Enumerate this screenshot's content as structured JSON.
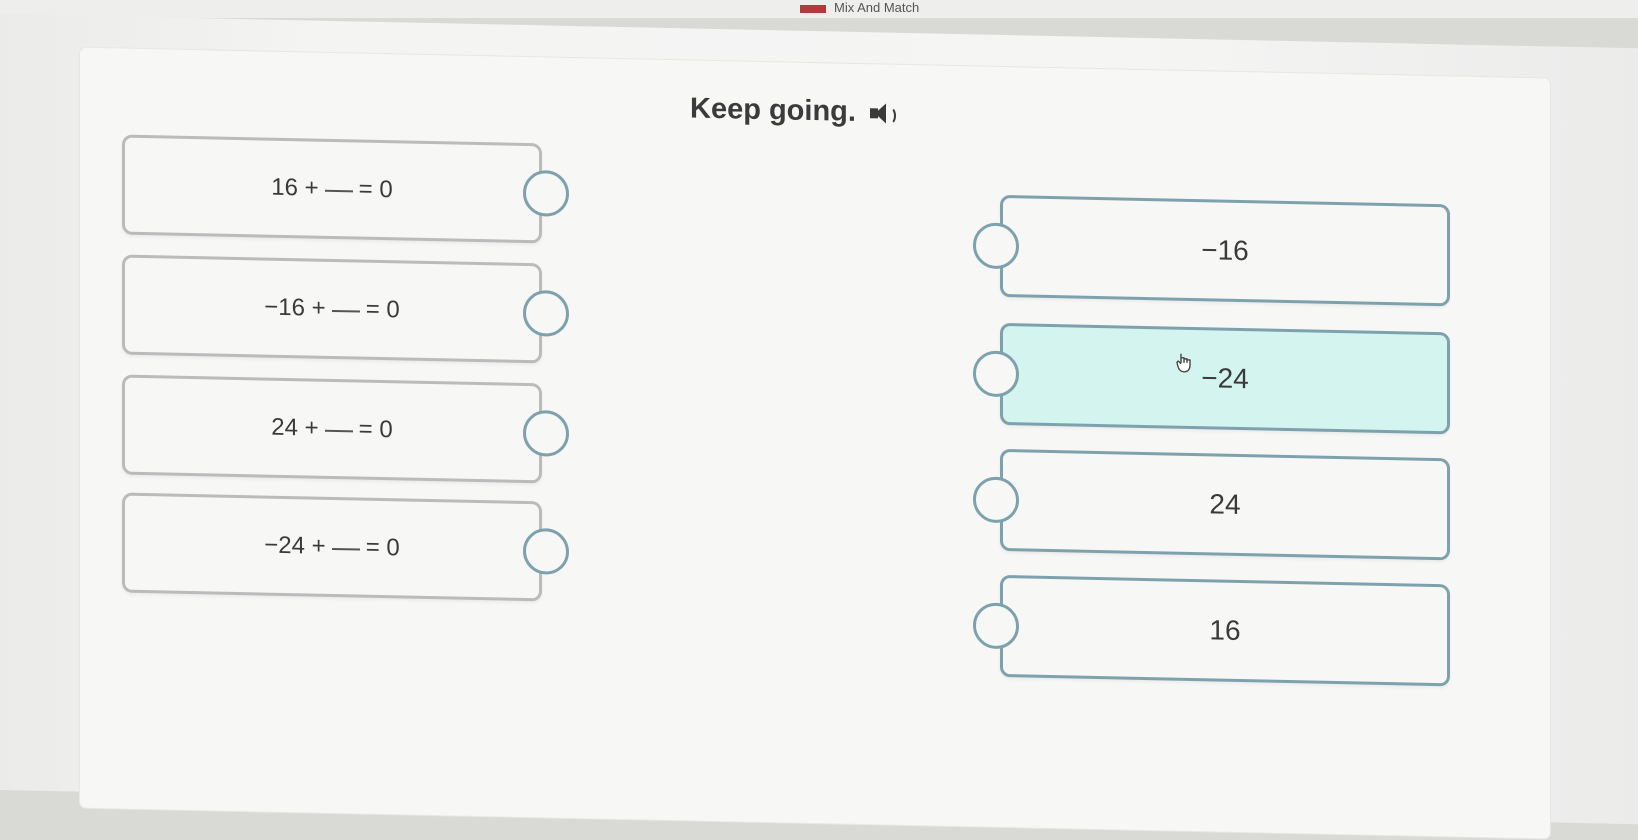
{
  "window": {
    "title": "Mix And Match"
  },
  "prompt": {
    "text": "Keep going.",
    "audio_icon": "speaker-icon"
  },
  "left_items": [
    {
      "left": "16 +",
      "blank": "__",
      "right": "= 0"
    },
    {
      "left": "−16 +",
      "blank": "__",
      "right": "= 0"
    },
    {
      "left": "24 +",
      "blank": "__",
      "right": "= 0"
    },
    {
      "left": "−24 +",
      "blank": "__",
      "right": "= 0"
    }
  ],
  "right_items": [
    {
      "label": "−16",
      "selected": false
    },
    {
      "label": "−24",
      "selected": true
    },
    {
      "label": "24",
      "selected": false
    },
    {
      "label": "16",
      "selected": false
    }
  ],
  "colors": {
    "selected_fill": "#d4f4ef",
    "tile_border": "#7ea2ad"
  }
}
